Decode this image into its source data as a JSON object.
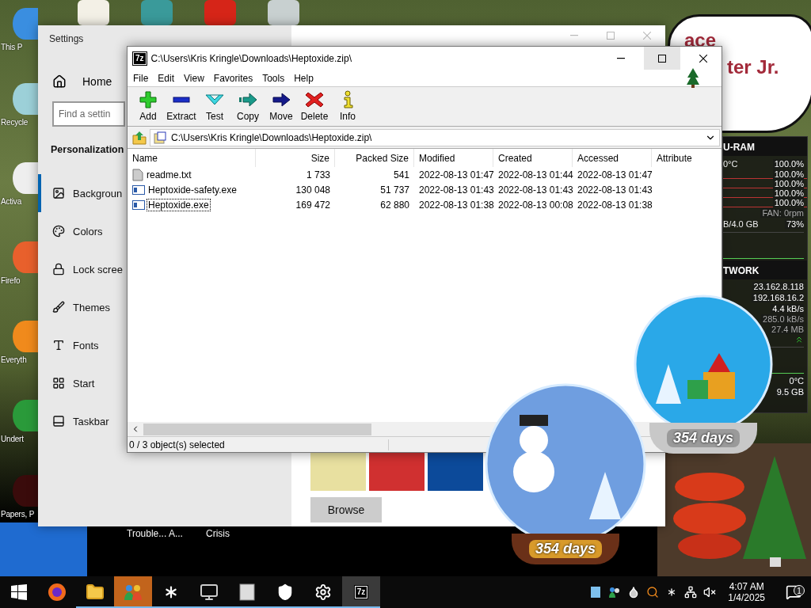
{
  "desktop": {
    "top_icons": [
      {
        "kind": "notepad"
      },
      {
        "kind": "character"
      },
      {
        "kind": "arches"
      },
      {
        "kind": "santa"
      }
    ],
    "icons": [
      {
        "label": "This P",
        "kind": "monitor"
      },
      {
        "label": "Recycle",
        "kind": "recycle"
      },
      {
        "label": "Activa",
        "kind": "papers"
      },
      {
        "label": "Firefo",
        "kind": "firefox"
      },
      {
        "label": "Everyth",
        "kind": "search"
      },
      {
        "label": "Undert",
        "kind": "character"
      },
      {
        "label": "Papers, P",
        "kind": "dark"
      }
    ],
    "bottom_labels": [
      "Trouble... A...",
      "Crisis"
    ]
  },
  "speech_bubble": {
    "lines": [
      "ace",
      "ter Jr."
    ]
  },
  "settings": {
    "title": "Settings",
    "home": "Home",
    "search": {
      "placeholder": "Find a settin"
    },
    "section": "Personalization",
    "items": [
      {
        "label": "Backgroun",
        "kind": "background",
        "selected": true
      },
      {
        "label": "Colors",
        "kind": "colors",
        "selected": false
      },
      {
        "label": "Lock scree",
        "kind": "lock",
        "selected": false
      },
      {
        "label": "Themes",
        "kind": "themes",
        "selected": false
      },
      {
        "label": "Fonts",
        "kind": "fonts",
        "selected": false
      },
      {
        "label": "Start",
        "kind": "start",
        "selected": false
      },
      {
        "label": "Taskbar",
        "kind": "taskbar",
        "selected": false
      }
    ],
    "thumbnails": [
      {
        "kind": "cartoon"
      },
      {
        "kind": "cartoon-red"
      },
      {
        "kind": "blue"
      }
    ],
    "browse_button": "Browse"
  },
  "archive_window": {
    "app_badge": "7z",
    "title": "C:\\Users\\Kris Kringle\\Downloads\\Heptoxide.zip\\",
    "menu": [
      "File",
      "Edit",
      "View",
      "Favorites",
      "Tools",
      "Help"
    ],
    "toolbar": [
      {
        "kind": "add",
        "label": "Add"
      },
      {
        "kind": "extract",
        "label": "Extract"
      },
      {
        "kind": "test",
        "label": "Test"
      },
      {
        "kind": "copy",
        "label": "Copy"
      },
      {
        "kind": "move",
        "label": "Move"
      },
      {
        "kind": "delete",
        "label": "Delete"
      },
      {
        "kind": "info",
        "label": "Info"
      }
    ],
    "address": "C:\\Users\\Kris Kringle\\Downloads\\Heptoxide.zip\\",
    "columns": [
      "Name",
      "Size",
      "Packed Size",
      "Modified",
      "Created",
      "Accessed",
      "Attribute"
    ],
    "rows": [
      {
        "kind": "text",
        "focused": false,
        "cells": [
          "readme.txt",
          "1 733",
          "541",
          "2022-08-13 01:47",
          "2022-08-13 01:44",
          "2022-08-13 01:47"
        ]
      },
      {
        "kind": "exe",
        "focused": false,
        "cells": [
          "Heptoxide-safety.exe",
          "130 048",
          "51 737",
          "2022-08-13 01:43",
          "2022-08-13 01:43",
          "2022-08-13 01:43"
        ]
      },
      {
        "kind": "exe",
        "focused": true,
        "cells": [
          "Heptoxide.exe",
          "169 472",
          "62 880",
          "2022-08-13 01:38",
          "2022-08-13 00:08",
          "2022-08-13 01:38"
        ]
      }
    ],
    "status": "0 / 3 object(s) selected"
  },
  "system_monitor": {
    "cpu_header": "U-RAM",
    "cpu_temp": "0°C",
    "cores": [
      "100.0%",
      "100.0%",
      "100.0%",
      "100.0%",
      "100.0%"
    ],
    "fan": "FAN: 0rpm",
    "memory": "B/4.0 GB",
    "memory_percent": "73%",
    "network_header": "TWORK",
    "network": [
      "23.162.8.118",
      "192.168.16.2",
      "4.4 kB/s",
      "285.0 kB/s",
      "27.4 MB"
    ],
    "drive_temp": "0°C",
    "drive_free": "9.5 GB"
  },
  "snow_globes": [
    {
      "kind": "snowman",
      "label": "354 days"
    },
    {
      "kind": "presents",
      "label": "354 days"
    }
  ],
  "taskbar": {
    "apps": [
      {
        "kind": "start",
        "selected": false,
        "attention": false,
        "running": false
      },
      {
        "kind": "firefox",
        "selected": false,
        "attention": false,
        "running": false
      },
      {
        "kind": "folder",
        "selected": false,
        "attention": false,
        "running": true
      },
      {
        "kind": "people",
        "selected": false,
        "attention": true,
        "running": true
      },
      {
        "kind": "asterisk",
        "selected": false,
        "attention": false,
        "running": true
      },
      {
        "kind": "monitor",
        "selected": false,
        "attention": false,
        "running": true
      },
      {
        "kind": "square",
        "selected": false,
        "attention": false,
        "running": true
      },
      {
        "kind": "shield",
        "selected": false,
        "attention": false,
        "running": true
      },
      {
        "kind": "gear",
        "selected": false,
        "attention": false,
        "running": true
      },
      {
        "kind": "archiver",
        "label": "7z",
        "selected": true,
        "attention": false,
        "running": true
      }
    ],
    "tray": [
      {
        "kind": "square"
      },
      {
        "kind": "people"
      },
      {
        "kind": "drop"
      },
      {
        "kind": "search"
      },
      {
        "kind": "asterisk"
      },
      {
        "kind": "network"
      },
      {
        "kind": "mute"
      }
    ],
    "time": "4:07 AM",
    "date": "1/4/2025",
    "notifications": "1"
  }
}
